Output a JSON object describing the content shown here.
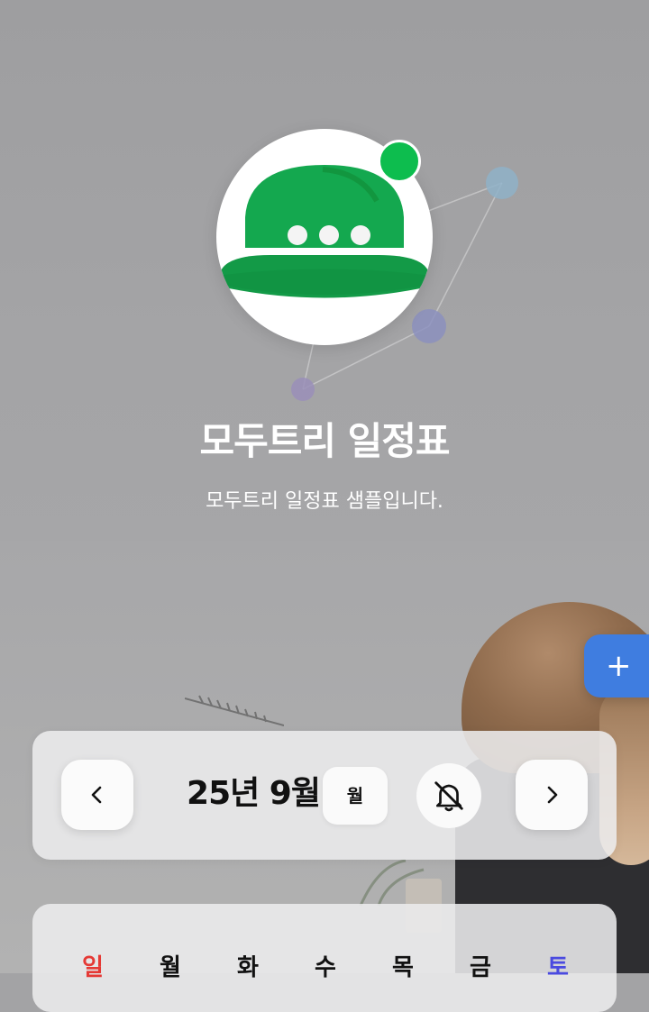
{
  "profile": {
    "title": "모두트리 일정표",
    "subtitle": "모두트리 일정표 샘플입니다.",
    "avatar_icon": "green-hardhat-chat-icon",
    "status_color": "#0dbd4e"
  },
  "fab": {
    "label": "+"
  },
  "calendar_nav": {
    "prev_icon": "chevron-left-icon",
    "month_label": "25년 9월",
    "view_label": "월",
    "bell_icon": "bell-off-icon",
    "next_icon": "chevron-right-icon"
  },
  "weekdays": [
    {
      "label": "일",
      "color": "#e53935"
    },
    {
      "label": "월",
      "color": "#111111"
    },
    {
      "label": "화",
      "color": "#111111"
    },
    {
      "label": "수",
      "color": "#111111"
    },
    {
      "label": "목",
      "color": "#111111"
    },
    {
      "label": "금",
      "color": "#111111"
    },
    {
      "label": "토",
      "color": "#4a4ae0"
    }
  ],
  "colors": {
    "accent": "#3f7de0",
    "brand_green": "#14a84f"
  }
}
